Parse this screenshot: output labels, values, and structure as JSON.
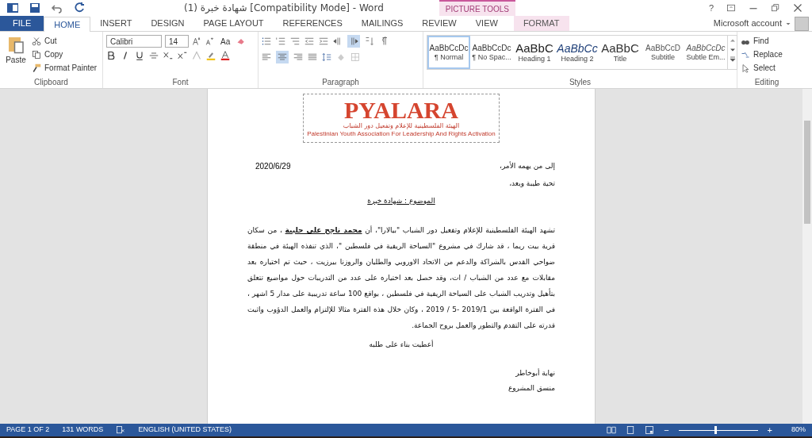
{
  "title_bar": {
    "title": "شهادة خبرة (1) [Compatibility Mode] - Word",
    "context_group": "PICTURE TOOLS",
    "account": "Microsoft account",
    "help": "?"
  },
  "tabs": [
    {
      "label": "FILE",
      "kind": "file",
      "selected": false
    },
    {
      "label": "HOME",
      "kind": "tab",
      "selected": true
    },
    {
      "label": "INSERT",
      "kind": "tab",
      "selected": false
    },
    {
      "label": "DESIGN",
      "kind": "tab",
      "selected": false
    },
    {
      "label": "PAGE LAYOUT",
      "kind": "tab",
      "selected": false
    },
    {
      "label": "REFERENCES",
      "kind": "tab",
      "selected": false
    },
    {
      "label": "MAILINGS",
      "kind": "tab",
      "selected": false
    },
    {
      "label": "REVIEW",
      "kind": "tab",
      "selected": false
    },
    {
      "label": "VIEW",
      "kind": "tab",
      "selected": false
    },
    {
      "label": "FORMAT",
      "kind": "context",
      "selected": false
    }
  ],
  "clipboard": {
    "paste": "Paste",
    "cut": "Cut",
    "copy": "Copy",
    "format_painter": "Format Painter",
    "label": "Clipboard"
  },
  "font": {
    "name": "Calibri",
    "size": "14",
    "case": "Aa",
    "label": "Font"
  },
  "paragraph": {
    "label": "Paragraph",
    "rtl_selected": true,
    "center_selected": true
  },
  "styles": {
    "label": "Styles",
    "items": [
      {
        "preview": "AaBbCcDc",
        "name": "¶ Normal",
        "kind": "normal",
        "selected": true
      },
      {
        "preview": "AaBbCcDc",
        "name": "¶ No Spac...",
        "kind": "normal",
        "selected": false
      },
      {
        "preview": "AaBbC",
        "name": "Heading 1",
        "kind": "heading",
        "selected": false
      },
      {
        "preview": "AaBbCc",
        "name": "Heading 2",
        "kind": "italic",
        "selected": false
      },
      {
        "preview": "AaBbC",
        "name": "Title",
        "kind": "title",
        "selected": false
      },
      {
        "preview": "AaBbCcD",
        "name": "Subtitle",
        "kind": "subtle",
        "selected": false
      },
      {
        "preview": "AaBbCcDc",
        "name": "Subtle Em...",
        "kind": "subtle_italic",
        "selected": false
      }
    ]
  },
  "editing": {
    "find": "Find",
    "replace": "Replace",
    "select": "Select",
    "label": "Editing"
  },
  "document": {
    "logo": {
      "wordmark": "PYALARA",
      "arabic": "الهيئة الفلسطينية للإعلام وتفعيل دور الشباب",
      "english": "Palestinian Youth Association For Leadership And Rights Activation"
    },
    "date": "2020/6/29",
    "greeting": "إلى من يهمه الأمر،",
    "salutation": "تحية طيبة وبعد،",
    "subject": "الموضوع : شهادة خبرة",
    "body": {
      "before": "تشهد الهيئة الفلسطينية للإعلام وتفعيل دور الشباب \"بيالارا\"، أن ",
      "name": "محمد ناجح علي حلبية",
      "after": "  ، من سكان قرية بيت ريما ، قد شارك في مشروع \"السياحة الريفية في فلسطين \"، الذي تنفذه الهيئة في منطقة ضواحي القدس بالشراكة والدعم من الاتحاد الاوروبي والطليان والروزنا  بيرزيت ، حيث تم اختياره بعد مقابلات مع عدد من الشباب / ات، وقد حصل بعد اختياره على عدد من التدريبات حول مواضيع تتعلق بتأهيل وتدريب  الشباب على السياحة الريفية في فلسطين ، بواقع 100 ساعة تدريبية على مدار 5 اشهر ، في الفترة الواقعة بين 2019/1 -5 / 2019 ، وكان خلال هذه الفترة مثالا للإلتزام والعمل الدؤوب واثبت قدرته على التقدم والتطور والعمل بروح الجماعة."
    },
    "closing": "أعطيت بناء على طلبه",
    "signer": "نهاية أبوخاطر",
    "role": "منسق المشروع"
  },
  "status_bar": {
    "page": "PAGE 1 OF 2",
    "words": "131 WORDS",
    "language": "ENGLISH (UNITED STATES)",
    "zoom": "80%",
    "zoom_out": "−",
    "zoom_in": "+",
    "zoom_level": {
      "level": 0.45
    }
  }
}
